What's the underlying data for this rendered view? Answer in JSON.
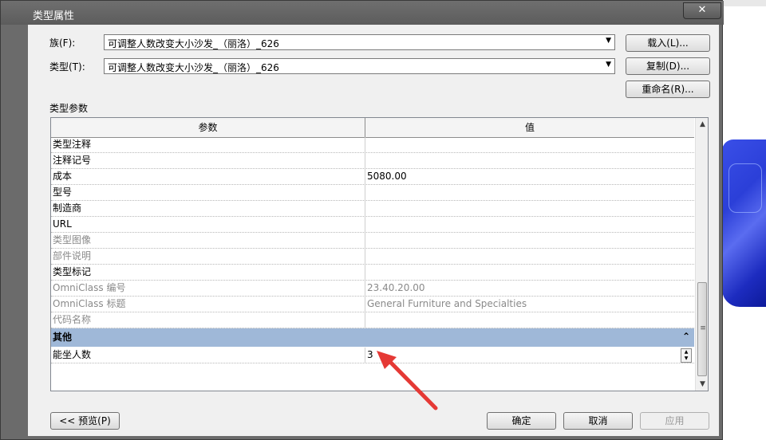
{
  "window": {
    "title": "类型属性",
    "close": "✕"
  },
  "family": {
    "label": "族(F):",
    "value": "可调整人数改变大小沙发_（丽洛）_626"
  },
  "type": {
    "label": "类型(T):",
    "value": "可调整人数改变大小沙发_（丽洛）_626"
  },
  "buttons": {
    "load": "载入(L)...",
    "duplicate": "复制(D)...",
    "rename": "重命名(R)...",
    "preview": "<< 预览(P)",
    "ok": "确定",
    "cancel": "取消",
    "apply": "应用"
  },
  "section_label": "类型参数",
  "grid": {
    "col_param": "参数",
    "col_value": "值",
    "rows": [
      {
        "k": "类型注释",
        "v": ""
      },
      {
        "k": "注释记号",
        "v": ""
      },
      {
        "k": "成本",
        "v": "5080.00"
      },
      {
        "k": "型号",
        "v": ""
      },
      {
        "k": "制造商",
        "v": ""
      },
      {
        "k": "URL",
        "v": ""
      },
      {
        "k": "类型图像",
        "v": ""
      },
      {
        "k": "部件说明",
        "v": ""
      },
      {
        "k": "类型标记",
        "v": ""
      },
      {
        "k": "OmniClass 编号",
        "v": "23.40.20.00"
      },
      {
        "k": "OmniClass 标题",
        "v": "General Furniture and Specialties"
      },
      {
        "k": "代码名称",
        "v": ""
      }
    ],
    "group": {
      "label": "其他",
      "chevron": "⌃"
    },
    "group_rows": [
      {
        "k": "能坐人数",
        "v": "3"
      }
    ]
  },
  "colors": {
    "group_bg": "#9fb8d8",
    "annotation": "#e53935",
    "dim_text": "#8a8a8a"
  }
}
